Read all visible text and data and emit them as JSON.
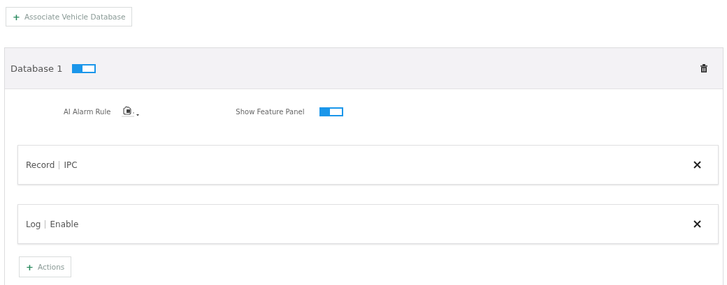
{
  "add_button": {
    "icon": "+",
    "label": "Associate Vehicle Database"
  },
  "database": {
    "title": "Database 1",
    "enabled": true,
    "ai_alarm_rule": {
      "label": "AI Alarm Rule"
    },
    "show_feature_panel": {
      "label": "Show Feature Panel",
      "on": true
    },
    "actions": [
      {
        "name": "Record",
        "value": "IPC"
      },
      {
        "name": "Log",
        "value": "Enable"
      }
    ],
    "add_action": {
      "icon": "+",
      "label": "Actions"
    }
  }
}
